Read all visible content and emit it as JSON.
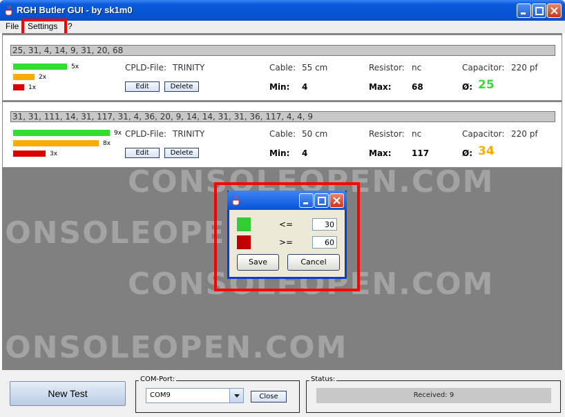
{
  "window": {
    "title": "RGH Butler GUI - by sk1m0",
    "menu": [
      "File",
      "Settings",
      "?"
    ]
  },
  "watermark": "CONSOLEOPEN.COM",
  "results": [
    {
      "sequence": "25, 31, 4, 14, 9, 31, 20, 68",
      "buckets": [
        {
          "label": "5x",
          "color": "#33dd33",
          "count": 5
        },
        {
          "label": "2x",
          "color": "#ffaa00",
          "count": 2
        },
        {
          "label": "1x",
          "color": "#dd0000",
          "count": 1
        }
      ],
      "cpld_label": "CPLD-File:",
      "cpld_value": "TRINITY",
      "cable_label": "Cable:",
      "cable_value": "55 cm",
      "resistor_label": "Resistor:",
      "resistor_value": "nc",
      "capacitor_label": "Capacitor:",
      "capacitor_value": "220 pf",
      "min_label": "Min:",
      "min_value": "4",
      "max_label": "Max:",
      "max_value": "68",
      "avg_label": "Ø:",
      "avg_value": "25",
      "avg_color": "#33dd33",
      "edit_label": "Edit",
      "delete_label": "Delete"
    },
    {
      "sequence": "31, 31, 111, 14, 31, 117, 31, 4, 36, 20, 9, 14, 14, 31, 31, 36, 117, 4, 4, 9",
      "buckets": [
        {
          "label": "9x",
          "color": "#33dd33",
          "count": 9
        },
        {
          "label": "8x",
          "color": "#ffaa00",
          "count": 8
        },
        {
          "label": "3x",
          "color": "#dd0000",
          "count": 3
        }
      ],
      "cpld_label": "CPLD-File:",
      "cpld_value": "TRINITY",
      "cable_label": "Cable:",
      "cable_value": "50 cm",
      "resistor_label": "Resistor:",
      "resistor_value": "nc",
      "capacitor_label": "Capacitor:",
      "capacitor_value": "220 pf",
      "min_label": "Min:",
      "min_value": "4",
      "max_label": "Max:",
      "max_value": "117",
      "avg_label": "Ø:",
      "avg_value": "34",
      "avg_color": "#ffaa00",
      "edit_label": "Edit",
      "delete_label": "Delete"
    }
  ],
  "dialog": {
    "rows": [
      {
        "color": "#33cc33",
        "operator": "<=",
        "value": "30"
      },
      {
        "color": "#c00000",
        "operator": ">=",
        "value": "60"
      }
    ],
    "save_label": "Save",
    "cancel_label": "Cancel"
  },
  "bottom": {
    "new_test_label": "New Test",
    "com_port_group": "COM-Port:",
    "com_port_value": "COM9",
    "close_label": "Close",
    "status_group": "Status:",
    "status_value": "Received: 9"
  },
  "colors": {
    "highlight": "#ff0000",
    "titlebar": "#0653d4"
  }
}
